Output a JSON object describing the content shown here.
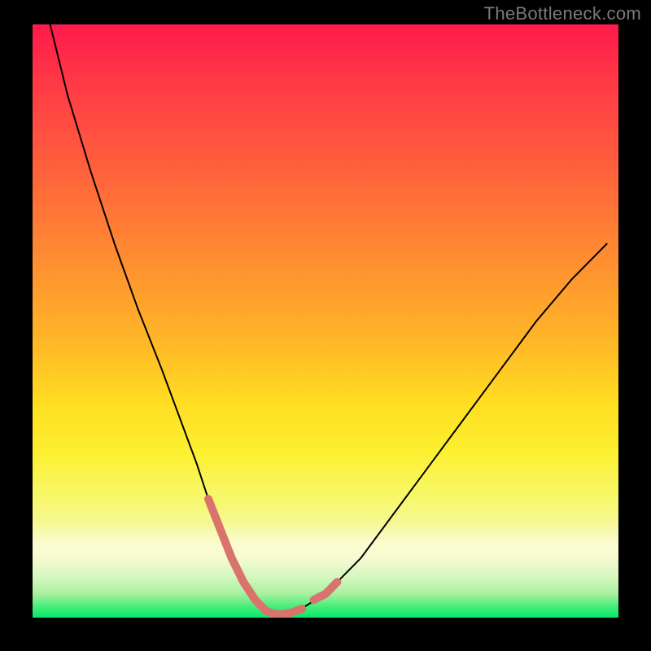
{
  "watermark": "TheBottleneck.com",
  "chart_data": {
    "type": "line",
    "title": "",
    "xlabel": "",
    "ylabel": "",
    "xlim": [
      0,
      100
    ],
    "ylim": [
      0,
      100
    ],
    "grid": false,
    "legend": false,
    "background": {
      "gradient_top_color": "#ff1a4b",
      "gradient_bottom_color": "#06e86a",
      "note": "vertical red→yellow→green gradient; green band at bottom"
    },
    "series": [
      {
        "name": "bottleneck-curve",
        "color": "#000000",
        "stroke_width": 2,
        "x": [
          3,
          6,
          10,
          14,
          18,
          22,
          25,
          28,
          30,
          32,
          34,
          36,
          38,
          40,
          42,
          45,
          50,
          56,
          62,
          68,
          74,
          80,
          86,
          92,
          98
        ],
        "values": [
          100,
          88,
          75,
          63,
          52,
          42,
          34,
          26,
          20,
          15,
          10,
          6,
          3,
          1,
          0.5,
          1,
          4,
          10,
          18,
          26,
          34,
          42,
          50,
          57,
          63
        ]
      },
      {
        "name": "highlight-segments",
        "color": "#d9736e",
        "stroke_width": 10,
        "note": "thick salmon overlay near valley and just right of valley",
        "segments": [
          {
            "x": [
              30,
              32,
              34,
              36,
              38,
              40,
              42,
              44,
              46
            ],
            "values": [
              20,
              15,
              10,
              6,
              3,
              1,
              0.5,
              0.8,
              1.5
            ]
          },
          {
            "x": [
              48,
              50,
              52
            ],
            "values": [
              3,
              4,
              6
            ]
          }
        ]
      }
    ]
  }
}
